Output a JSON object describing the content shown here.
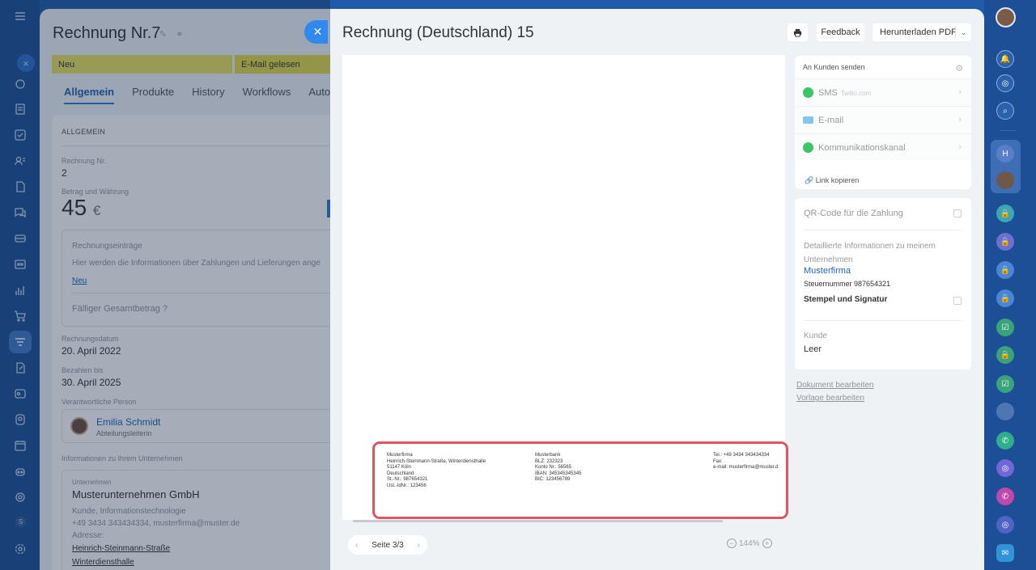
{
  "deal": {
    "title": "Rechnung Nr.7",
    "stages": [
      "Neu",
      "E-Mail gelesen"
    ],
    "tabs": [
      "Allgemein",
      "Produkte",
      "History",
      "Workflows",
      "Autom"
    ],
    "section_heading": "ALLGEMEIN",
    "invoice_no_label": "Rechnung Nr.",
    "invoice_no": "2",
    "amount_label": "Betrag und Währung",
    "amount": "45",
    "currency": "€",
    "entries_label": "Rechnungseinträge",
    "entries_hint": "Hier werden die Informationen über Zahlungen und Lieferungen ange",
    "entries_new": "Neu",
    "due_total_label": "Fälliger Gesamtbetrag",
    "invoice_date_label": "Rechnungsdatum",
    "invoice_date": "20. April 2022",
    "pay_by_label": "Bezahlen bis",
    "pay_by": "30. April 2025",
    "responsible_label": "Verantwortliche Person",
    "responsible_name": "Emilia Schmidt",
    "responsible_role": "Abteilungsleiterin",
    "company_section": "Informationen zu Ihrem Unternehmen",
    "company_label": "Unternehmen",
    "company_name": "Musterunternehmen GmbH",
    "company_meta": "Kunde, Informationstechnologie",
    "company_contact": "+49 3434 343434334, musterfirma@muster.de",
    "address_label": "Adresse:",
    "address_1": "Heinrich-Steinmann-Straße",
    "address_2": "Winterdiensthalle"
  },
  "slider": {
    "title": "Rechnung (Deutschland) 15",
    "feedback": "Feedback",
    "download": "Herunterladen PDF",
    "page": "Seite 3/3",
    "zoom": "144%",
    "footer": {
      "col1": [
        "Musterfirma",
        "Heinrich-Steinmann-Straße, Winterdiensthalle",
        "51147 Köln",
        "Deutschland",
        "St.-Nr.: 987654321",
        "Ust.-IdNr.: 123456"
      ],
      "col2": [
        "Musterbank",
        "BLZ: 232323",
        "Konto Nr.: 56565",
        "IBAN: 345345345345",
        "BIC: 123456789"
      ],
      "col3": [
        "Tel.: +49 3434 343434334",
        "Fax:",
        "e-mail: musterfirma@muster.d"
      ]
    },
    "send": {
      "title": "An Kunden senden",
      "sms": "SMS",
      "sms_provider": "Twilio.com",
      "email": "E-mail",
      "channel": "Kommunikationskanal",
      "copy_link": "Link kopieren"
    },
    "info": {
      "qr": "QR-Code für die Zahlung",
      "details": "Detaillierte Informationen zu meinem Unternehmen",
      "firm": "Musterfirma",
      "tax": "Steuernummer 987654321",
      "stamp": "Stempel und Signatur",
      "customer_label": "Kunde",
      "customer_value": "Leer"
    },
    "edit_document": "Dokument bearbeiten",
    "edit_template": "Vorlage bearbeiten"
  },
  "colors": {
    "accent": "#2f7ad6",
    "highlight": "#e05562",
    "stage_new": "#e8e25e",
    "stage_read": "#e3d947"
  },
  "right_rail": {
    "group_letter": "H"
  },
  "left_rail": {
    "bottom_letter": "S"
  }
}
